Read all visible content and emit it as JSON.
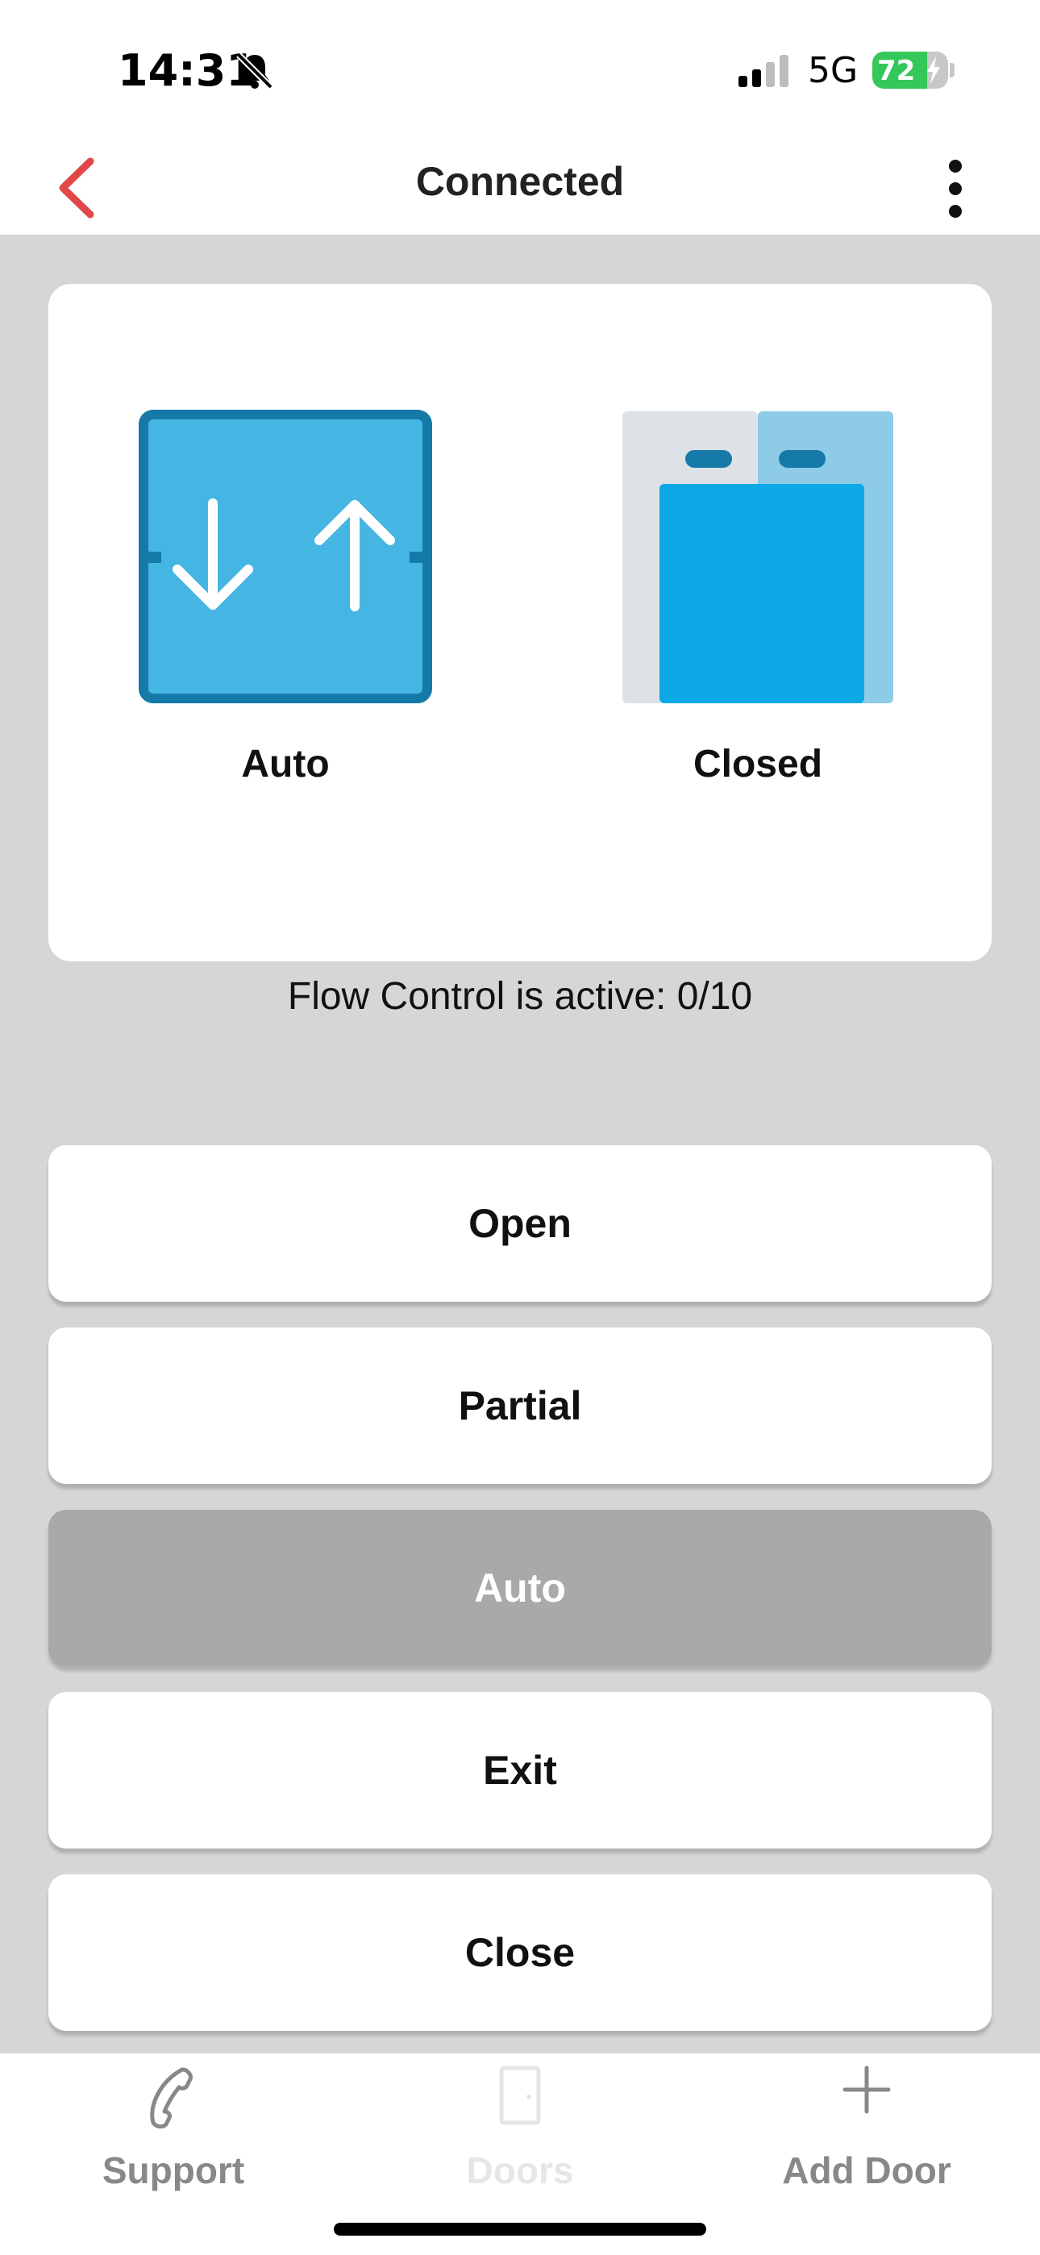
{
  "status_bar": {
    "time": "14:31",
    "network": "5G",
    "battery": "72",
    "battery_level": 0.72,
    "icons": [
      "bell-slash-icon",
      "signal-icon",
      "battery-charging-icon"
    ]
  },
  "navbar": {
    "title": "Connected",
    "back_icon": "chevron-left-icon",
    "more_icon": "vertical-ellipsis-icon",
    "accent_color": "#e04848"
  },
  "status_card": {
    "mode_label": "Auto",
    "mode_icon": "auto-mode-arrows-icon",
    "door_label": "Closed",
    "door_icon": "closed-door-icon",
    "icon_colors": {
      "mode_fill": "#45b6e3",
      "mode_border": "#167aa8",
      "door_fill": "#0da9e6"
    }
  },
  "flow_control_text": "Flow Control is active: 0/10",
  "actions": {
    "open": "Open",
    "partial": "Partial",
    "auto": "Auto",
    "exit": "Exit",
    "close": "Close",
    "selected": "auto",
    "selected_color": "#a9a9a9"
  },
  "tabbar": {
    "support": "Support",
    "doors": "Doors",
    "add_door": "Add Door",
    "icons": [
      "phone-icon",
      "door-icon",
      "plus-icon"
    ],
    "label_color": "#888888",
    "disabled_color": "#e6e6e6"
  }
}
